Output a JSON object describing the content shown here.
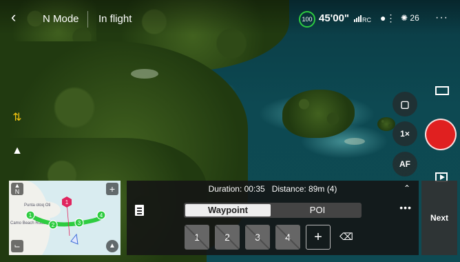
{
  "topbar": {
    "mode": "N Mode",
    "status": "In flight",
    "battery": "100",
    "flight_time": "45'00\"",
    "rc_label": "RC",
    "satellites": "26"
  },
  "camera": {
    "zoom_label": "1×",
    "focus_label": "AF"
  },
  "minimap": {
    "place_labels": [
      "Punta otoq Oti",
      "Camo Beach Road"
    ],
    "waypoint_markers": [
      "1",
      "2",
      "3",
      "4"
    ],
    "poi_marker": "1",
    "north_label": "N"
  },
  "panel": {
    "duration_label": "Duration: 00:35",
    "distance_label": "Distance: 89m (4)",
    "tabs": [
      {
        "label": "Waypoint",
        "active": true
      },
      {
        "label": "POI",
        "active": false
      }
    ],
    "waypoints": [
      "1",
      "2",
      "3",
      "4"
    ],
    "add_label": "+"
  },
  "next_label": "Next",
  "colors": {
    "record": "#e02020",
    "battery_ring": "#2ecc40",
    "route": "#2ecc40",
    "poi": "#e0245e"
  }
}
